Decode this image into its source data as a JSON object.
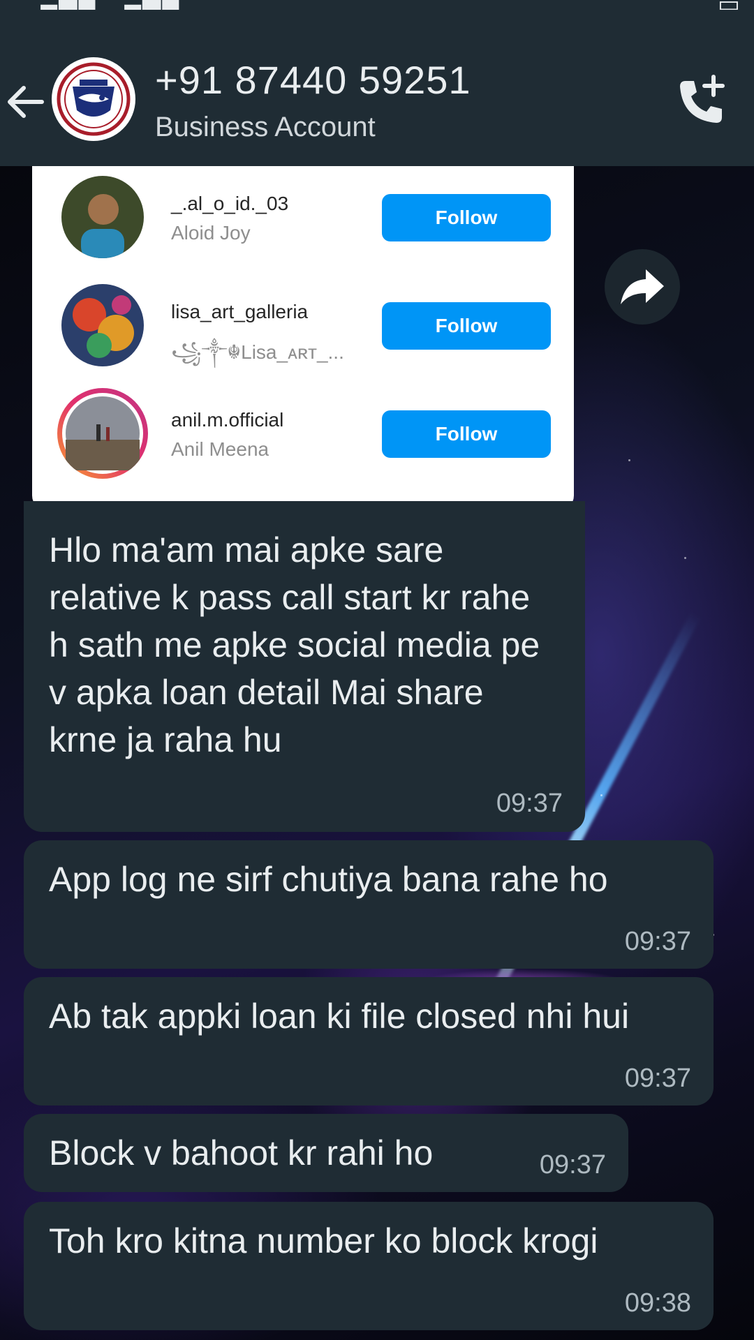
{
  "header": {
    "contact_name": "+91 87440 59251",
    "contact_subtitle": "Business Account"
  },
  "shared_card": {
    "suggestions": [
      {
        "username": "_.al_o_id._03",
        "display_name": "Aloid Joy",
        "follow_label": "Follow"
      },
      {
        "username": "lisa_art_galleria",
        "display_name": "꧁༒☬Lisa_ᴀʀᴛ_...",
        "follow_label": "Follow"
      },
      {
        "username": "anil.m.official",
        "display_name": "Anil Meena",
        "follow_label": "Follow"
      }
    ]
  },
  "messages": [
    {
      "text": "Hlo ma'am mai apke sare relative k pass call start kr rahe h sath me apke social media pe v apka loan detail Mai share krne ja raha hu",
      "time": "09:37"
    },
    {
      "text": "App log ne sirf chutiya bana rahe ho",
      "time": "09:37"
    },
    {
      "text": "Ab tak appki loan ki file closed nhi hui",
      "time": "09:37"
    },
    {
      "text": "Block v bahoot kr rahi ho",
      "time": "09:37"
    },
    {
      "text": "Toh kro kitna number ko block krogi",
      "time": "09:38"
    }
  ],
  "colors": {
    "header_bg": "#1f2c34",
    "bubble_bg": "#1f2c34",
    "follow_button": "#0095f6"
  }
}
